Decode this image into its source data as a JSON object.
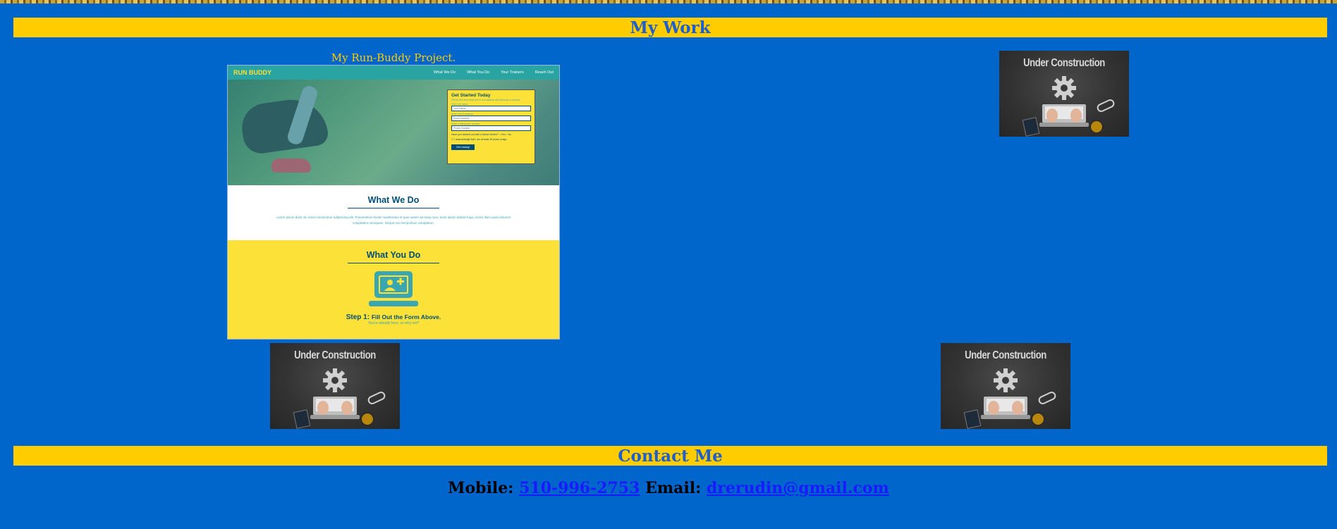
{
  "sections": {
    "work_title": "My Work",
    "contact_title": "Contact Me"
  },
  "project": {
    "caption": "My Run-Buddy Project.",
    "screenshot": {
      "logo": "RUN BUDDY",
      "nav": [
        "What We Do",
        "What You Do",
        "Your Trainers",
        "Reach Out"
      ],
      "form": {
        "title": "Get Started Today",
        "intro": "Fill out this form and one of our trainers will schedule a consult.",
        "name_label": "Enter full name",
        "name_placeholder": "Your Name",
        "email_label": "Enter email address",
        "email_placeholder": "Email Address",
        "phone_label": "Enter a telephone number",
        "phone_placeholder": "Phone Number",
        "radio_text": "Have you worked out with a trainer before?",
        "radio_yes": "Yes",
        "radio_no": "No",
        "checkbox_text": "I acknowledge that I am at least 18 years of age.",
        "button": "Get running!"
      },
      "what_we_do": {
        "title": "What We Do",
        "text": "Lorem ipsum dolor sit, amet consectetur adipisicing elit. Praesentium facilis repellendus et quis autem ad sequ num, enim ipsam debitis fuga, omnis illum quas dolorem voluptatem numquam. Neque non temporibus voluptatem."
      },
      "what_you_do": {
        "title": "What You Do",
        "step_label": "Step 1:",
        "step_text": "Fill Out the Form Above.",
        "step_sub": "You're already here, so why not?"
      }
    }
  },
  "under_construction": {
    "title": "Under Construction"
  },
  "contact": {
    "mobile_label": "Mobile:",
    "mobile_value": "510-996-2753",
    "email_label": "Email:",
    "email_value": "drerudin@gmail.com"
  },
  "colors": {
    "background": "#0066cc",
    "bar": "#ffcc00",
    "bar_text": "#1f5fc9",
    "link": "#1a1aff"
  }
}
